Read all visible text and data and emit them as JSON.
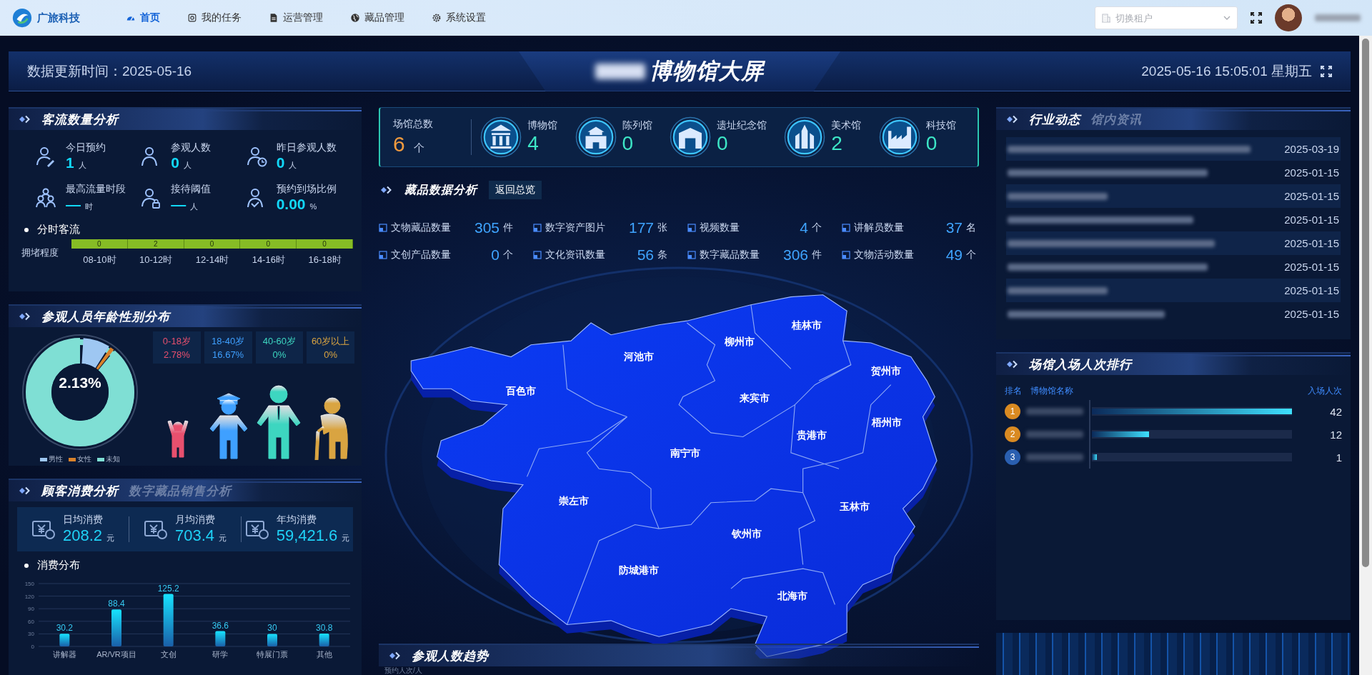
{
  "nav": {
    "logo": "广旅科技",
    "items": [
      {
        "label": "首页",
        "kind": "dashboard",
        "selected": true
      },
      {
        "label": "我的任务",
        "kind": "task",
        "selected": false
      },
      {
        "label": "运营管理",
        "kind": "document",
        "selected": false
      },
      {
        "label": "藏品管理",
        "kind": "globe",
        "selected": false
      },
      {
        "label": "系统设置",
        "kind": "gear",
        "selected": false
      }
    ],
    "tenant_select": {
      "placeholder": "切换租户"
    }
  },
  "header": {
    "update_time": "数据更新时间：2025-05-16",
    "title": "博物馆大屏",
    "datetime": "2025-05-16 15:05:01 星期五"
  },
  "visitor_panel": {
    "title": "客流数量分析",
    "stats": [
      {
        "label": "今日预约",
        "value": "1",
        "unit": "人",
        "kind": "edit"
      },
      {
        "label": "参观人数",
        "value": "0",
        "unit": "人",
        "kind": "person"
      },
      {
        "label": "昨日参观人数",
        "value": "0",
        "unit": "人",
        "kind": "clock"
      },
      {
        "label": "最高流量时段",
        "value": "—",
        "unit": "时",
        "kind": "group"
      },
      {
        "label": "接待阈值",
        "value": "—",
        "unit": "人",
        "kind": "lock"
      },
      {
        "label": "预约到场比例",
        "value": "0.00",
        "unit": "%",
        "kind": "check"
      }
    ],
    "section": "分时客流",
    "row_label": "拥堵程度",
    "slots": [
      {
        "value": "0",
        "time": "08-10时"
      },
      {
        "value": "2",
        "time": "10-12时"
      },
      {
        "value": "0",
        "time": "12-14时"
      },
      {
        "value": "0",
        "time": "14-16时"
      },
      {
        "value": "0",
        "time": "16-18时"
      }
    ]
  },
  "demographics_panel": {
    "title": "参观人员年龄性别分布",
    "donut_center": "2.13%",
    "legend": [
      {
        "label": "男性",
        "color": "#9ec7f2"
      },
      {
        "label": "女性",
        "color": "#d9822b"
      },
      {
        "label": "未知",
        "color": "#7fdfd4"
      }
    ],
    "age_groups": [
      {
        "label": "0-18岁",
        "value": "2.78%",
        "color": "#e8506e",
        "kind": "child"
      },
      {
        "label": "18-40岁",
        "value": "16.67%",
        "color": "#3fa0ff",
        "kind": "student"
      },
      {
        "label": "40-60岁",
        "value": "0%",
        "color": "#3dd6c0",
        "kind": "adult"
      },
      {
        "label": "60岁以上",
        "value": "0%",
        "color": "#d9a441",
        "kind": "elder"
      }
    ]
  },
  "consumption_panel": {
    "tabs": [
      {
        "label": "顾客消费分析",
        "selected": true
      },
      {
        "label": "数字藏品销售分析",
        "selected": false
      }
    ],
    "stats": [
      {
        "label": "日均消费",
        "value": "208.2",
        "unit": "元"
      },
      {
        "label": "月均消费",
        "value": "703.4",
        "unit": "元"
      },
      {
        "label": "年均消费",
        "value": "59,421.6",
        "unit": "元"
      }
    ],
    "section": "消费分布",
    "chart_data": {
      "type": "bar",
      "categories": [
        "讲解器",
        "AR/VR项目",
        "文创",
        "研学",
        "特展门票",
        "其他"
      ],
      "values": [
        30.2,
        88.4,
        125.2,
        36.6,
        30,
        30.8
      ],
      "ylim": [
        0,
        150
      ],
      "yticks": [
        0,
        30,
        60,
        90,
        120,
        150
      ],
      "grid": true,
      "data_labels": true
    }
  },
  "venues": {
    "total": {
      "label": "场馆总数",
      "value": "6",
      "unit": "个"
    },
    "types": [
      {
        "label": "博物馆",
        "value": "4",
        "kind": "museum"
      },
      {
        "label": "陈列馆",
        "value": "0",
        "kind": "hall"
      },
      {
        "label": "遗址纪念馆",
        "value": "0",
        "kind": "memorial"
      },
      {
        "label": "美术馆",
        "value": "2",
        "kind": "art"
      },
      {
        "label": "科技馆",
        "value": "0",
        "kind": "science"
      }
    ]
  },
  "collection_panel": {
    "title": "藏品数据分析",
    "back_button": "返回总览",
    "metrics": [
      {
        "label": "文物藏品数量",
        "value": "305",
        "unit": "件"
      },
      {
        "label": "数字资产图片",
        "value": "177",
        "unit": "张"
      },
      {
        "label": "视频数量",
        "value": "4",
        "unit": "个"
      },
      {
        "label": "讲解员数量",
        "value": "37",
        "unit": "名"
      },
      {
        "label": "文创产品数量",
        "value": "0",
        "unit": "个"
      },
      {
        "label": "文化资讯数量",
        "value": "56",
        "unit": "条"
      },
      {
        "label": "数字藏品数量",
        "value": "306",
        "unit": "件"
      },
      {
        "label": "文物活动数量",
        "value": "49",
        "unit": "个"
      }
    ]
  },
  "map": {
    "cities": [
      "桂林市",
      "柳州市",
      "河池市",
      "百色市",
      "贺州市",
      "来宾市",
      "梧州市",
      "贵港市",
      "南宁市",
      "崇左市",
      "玉林市",
      "钦州市",
      "防城港市",
      "北海市"
    ]
  },
  "trend_panel": {
    "title": "参观人数趋势",
    "axis_label": "预约人次/人"
  },
  "news_panel": {
    "tabs": [
      {
        "label": "行业动态",
        "selected": true
      },
      {
        "label": "馆内资讯",
        "selected": false
      }
    ],
    "items": [
      {
        "date": "2025-03-19"
      },
      {
        "date": "2025-01-15"
      },
      {
        "date": "2025-01-15"
      },
      {
        "date": "2025-01-15"
      },
      {
        "date": "2025-01-15"
      },
      {
        "date": "2025-01-15"
      },
      {
        "date": "2025-01-15"
      },
      {
        "date": "2025-01-15"
      }
    ]
  },
  "ranking_panel": {
    "title": "场馆入场人次排行",
    "columns": [
      "排名",
      "博物馆名称",
      "入场人次"
    ],
    "rows": [
      {
        "rank": "1",
        "count": "42",
        "level": 1,
        "color": "#d98a22"
      },
      {
        "rank": "2",
        "count": "12",
        "level": 0.286,
        "color": "#d98a22"
      },
      {
        "rank": "3",
        "count": "1",
        "level": 0.024,
        "color": "#2a5fb0"
      }
    ]
  }
}
